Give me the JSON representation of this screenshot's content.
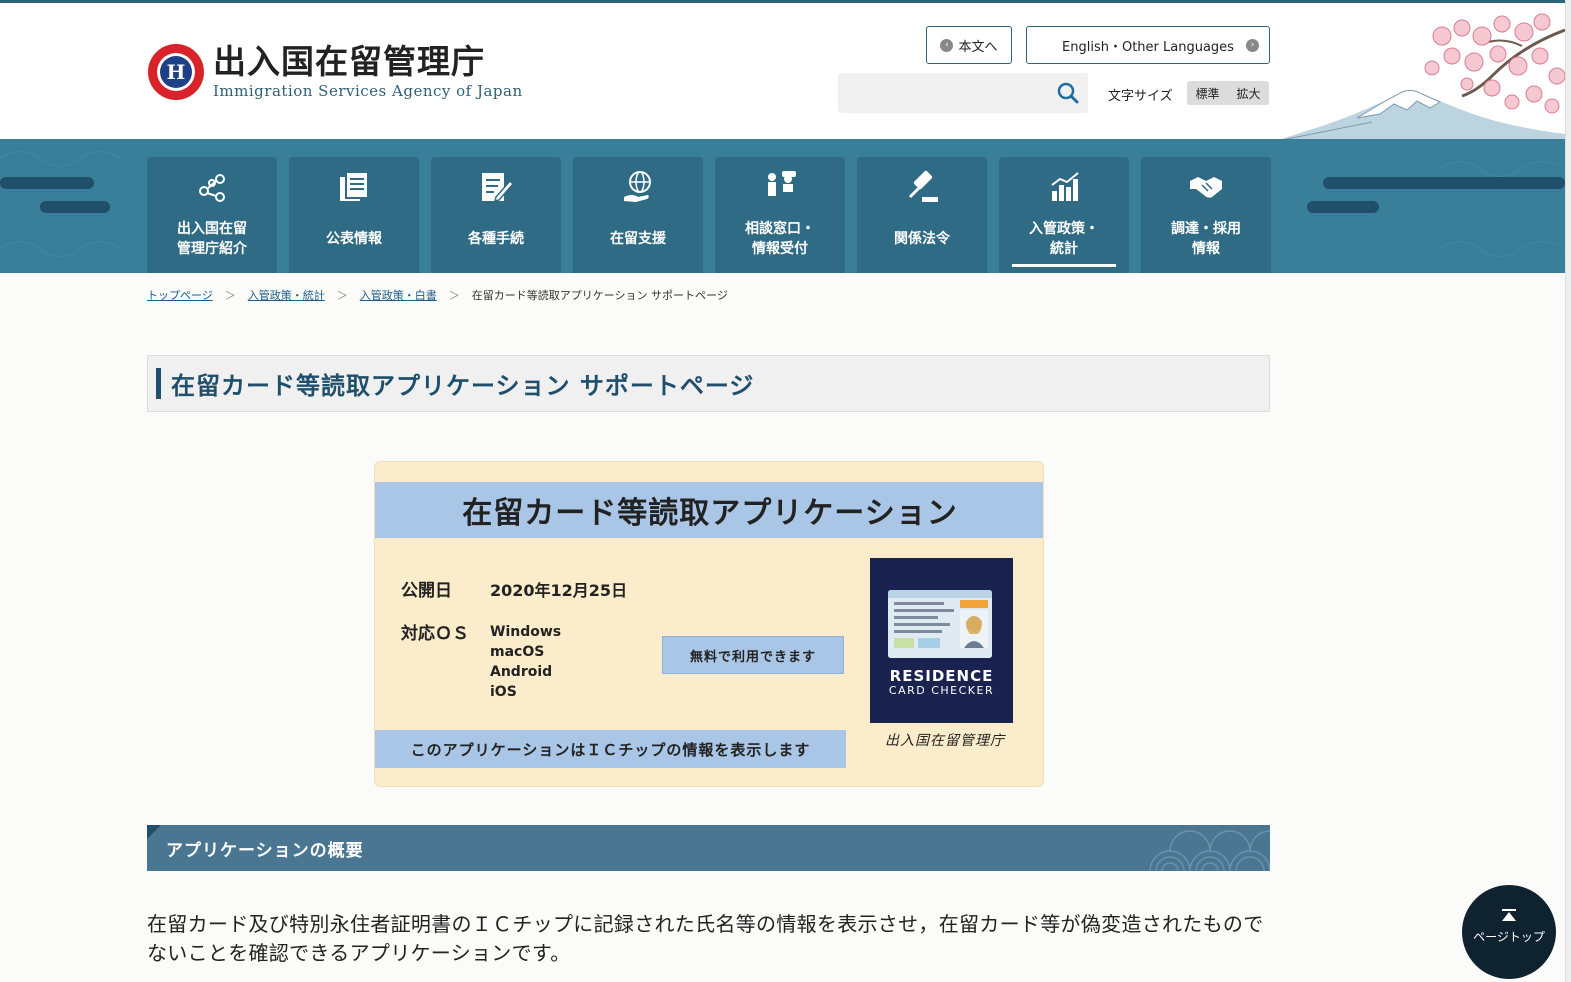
{
  "header": {
    "logo_ja": "出入国在留管理庁",
    "logo_en": "Immigration Services Agency of Japan",
    "honbun_label": "本文へ",
    "lang_label": "English・Other Languages",
    "search_placeholder": "",
    "fontsize_label": "文字サイズ",
    "fontsize_standard": "標準",
    "fontsize_large": "拡大"
  },
  "nav": {
    "items": [
      {
        "label": "出入国在留\n管理庁紹介",
        "icon": "org-icon"
      },
      {
        "label": "公表情報",
        "icon": "documents-icon"
      },
      {
        "label": "各種手続",
        "icon": "form-pen-icon"
      },
      {
        "label": "在留支援",
        "icon": "globe-hand-icon"
      },
      {
        "label": "相談窓口・\n情報受付",
        "icon": "consultation-icon"
      },
      {
        "label": "関係法令",
        "icon": "gavel-icon"
      },
      {
        "label": "入管政策・\n統計",
        "icon": "bar-chart-icon"
      },
      {
        "label": "調達・採用\n情報",
        "icon": "handshake-icon"
      }
    ]
  },
  "breadcrumb": {
    "items": [
      "トップページ",
      "入管政策・統計",
      "入管政策・白書"
    ],
    "current": "在留カード等読取アプリケーション サポートページ"
  },
  "page": {
    "title": "在留カード等読取アプリケーション サポートページ"
  },
  "banner": {
    "title": "在留カード等読取アプリケーション",
    "release_label": "公開日",
    "release_date": "2020年12月25日",
    "os_label": "対応ＯＳ",
    "os": [
      "Windows",
      "macOS",
      "Android",
      "iOS"
    ],
    "free_label": "無料で利用できます",
    "ic_label": "このアプリケーションはＩＣチップの情報を表示します",
    "card_brand1": "RESIDENCE",
    "card_brand2": "CARD CHECKER",
    "agency_sign": "出入国在留管理庁"
  },
  "section": {
    "title": "アプリケーションの概要",
    "description": "在留カード及び特別永住者証明書のＩＣチップに記録された氏名等の情報を表示させ，在留カード等が偽変造されたものでないことを確認できるアプリケーションです。"
  },
  "pagetop": {
    "label": "ページトップ"
  },
  "colors": {
    "nav_band": "#3a7f99",
    "nav_item": "#2f6b84",
    "title_navy": "#1f4f6a",
    "banner_blue": "#a9c6e6",
    "banner_bg": "#fbeccb"
  }
}
